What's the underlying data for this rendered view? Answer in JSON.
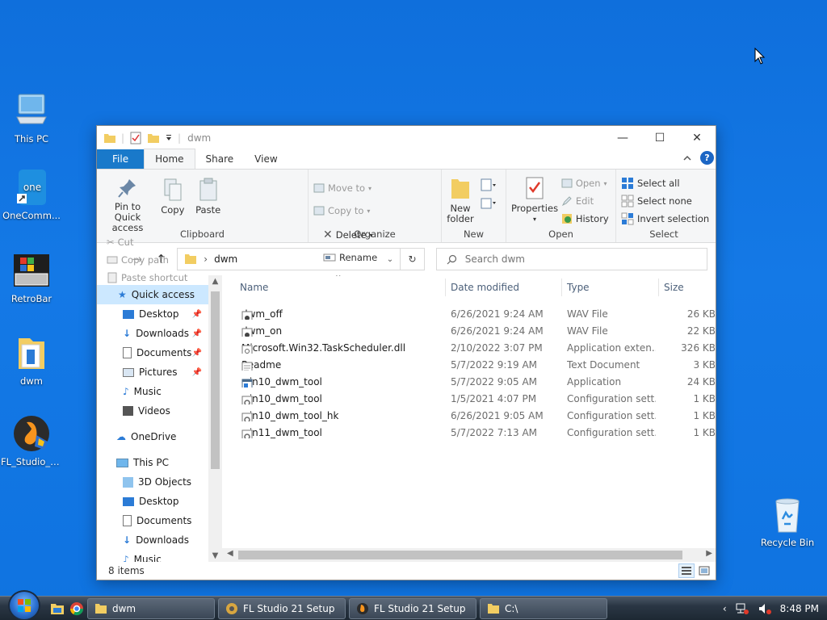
{
  "desktop": {
    "icons": [
      {
        "label": "This PC",
        "icon": "computer-icon"
      },
      {
        "label": "OneComm...",
        "icon": "onecommander-icon"
      },
      {
        "label": "RetroBar",
        "icon": "retrobar-icon"
      },
      {
        "label": "dwm",
        "icon": "folder-icon"
      },
      {
        "label": "FL_Studio_P...",
        "icon": "fl-studio-icon"
      },
      {
        "label": "Recycle Bin",
        "icon": "recycle-bin-icon"
      }
    ]
  },
  "window": {
    "title": "dwm",
    "controls": {
      "minimize": "—",
      "maximize": "☐",
      "close": "✕"
    }
  },
  "ribbon": {
    "tabs": [
      "File",
      "Home",
      "Share",
      "View"
    ],
    "active_tab": "Home",
    "clipboard": {
      "pin": "Pin to Quick access",
      "copy": "Copy",
      "paste": "Paste",
      "cut": "Cut",
      "copy_path": "Copy path",
      "paste_shortcut": "Paste shortcut",
      "group": "Clipboard"
    },
    "organize": {
      "move_to": "Move to",
      "copy_to": "Copy to",
      "delete": "Delete",
      "rename": "Rename",
      "group": "Organize"
    },
    "new": {
      "new_folder": "New folder",
      "group": "New"
    },
    "open": {
      "properties": "Properties",
      "open": "Open",
      "edit": "Edit",
      "history": "History",
      "group": "Open"
    },
    "select": {
      "select_all": "Select all",
      "select_none": "Select none",
      "invert": "Invert selection",
      "group": "Select"
    }
  },
  "address": {
    "path": "dwm",
    "search_placeholder": "Search dwm"
  },
  "nav_pane": {
    "items": [
      {
        "label": "Quick access",
        "icon": "star-icon",
        "level": 0,
        "selected": true
      },
      {
        "label": "Desktop",
        "icon": "desktop-icon",
        "level": 1,
        "pinned": true
      },
      {
        "label": "Downloads",
        "icon": "download-icon",
        "level": 1,
        "pinned": true
      },
      {
        "label": "Documents",
        "icon": "document-icon",
        "level": 1,
        "pinned": true
      },
      {
        "label": "Pictures",
        "icon": "pictures-icon",
        "level": 1,
        "pinned": true
      },
      {
        "label": "Music",
        "icon": "music-icon",
        "level": 1
      },
      {
        "label": "Videos",
        "icon": "videos-icon",
        "level": 1
      },
      {
        "label": "OneDrive",
        "icon": "cloud-icon",
        "level": 0
      },
      {
        "label": "This PC",
        "icon": "computer-icon",
        "level": 0
      },
      {
        "label": "3D Objects",
        "icon": "cube-icon",
        "level": 1
      },
      {
        "label": "Desktop",
        "icon": "desktop-icon",
        "level": 1
      },
      {
        "label": "Documents",
        "icon": "document-icon",
        "level": 1
      },
      {
        "label": "Downloads",
        "icon": "download-icon",
        "level": 1
      },
      {
        "label": "Music",
        "icon": "music-icon",
        "level": 1
      }
    ]
  },
  "file_list": {
    "columns": [
      "Name",
      "Date modified",
      "Type",
      "Size"
    ],
    "rows": [
      {
        "name": "dwm_off",
        "date": "6/26/2021 9:24 AM",
        "type": "WAV File",
        "size": "26 KB",
        "icon": "audio-file-icon"
      },
      {
        "name": "dwm_on",
        "date": "6/26/2021 9:24 AM",
        "type": "WAV File",
        "size": "22 KB",
        "icon": "audio-file-icon"
      },
      {
        "name": "Microsoft.Win32.TaskScheduler.dll",
        "date": "2/10/2022 3:07 PM",
        "type": "Application exten...",
        "size": "326 KB",
        "icon": "dll-file-icon"
      },
      {
        "name": "Readme",
        "date": "5/7/2022 9:19 AM",
        "type": "Text Document",
        "size": "3 KB",
        "icon": "text-file-icon"
      },
      {
        "name": "win10_dwm_tool",
        "date": "5/7/2022 9:05 AM",
        "type": "Application",
        "size": "24 KB",
        "icon": "app-icon"
      },
      {
        "name": "win10_dwm_tool",
        "date": "1/5/2021 4:07 PM",
        "type": "Configuration sett...",
        "size": "1 KB",
        "icon": "config-file-icon"
      },
      {
        "name": "win10_dwm_tool_hk",
        "date": "6/26/2021 9:05 AM",
        "type": "Configuration sett...",
        "size": "1 KB",
        "icon": "config-file-icon"
      },
      {
        "name": "win11_dwm_tool",
        "date": "5/7/2022 7:13 AM",
        "type": "Configuration sett...",
        "size": "1 KB",
        "icon": "config-file-icon"
      }
    ]
  },
  "status": {
    "items_count": "8 items"
  },
  "taskbar": {
    "buttons": [
      {
        "label": "dwm",
        "icon": "folder-icon"
      },
      {
        "label": "FL Studio 21 Setup",
        "icon": "setup-icon"
      },
      {
        "label": "FL Studio 21 Setup",
        "icon": "fl-studio-icon"
      },
      {
        "label": "C:\\",
        "icon": "folder-icon"
      }
    ],
    "clock": "8:48 PM"
  },
  "colors": {
    "desktop": "#1479e6",
    "file_tab": "#1979ca",
    "selection": "#cce8ff",
    "accent": "#1c66c4"
  }
}
